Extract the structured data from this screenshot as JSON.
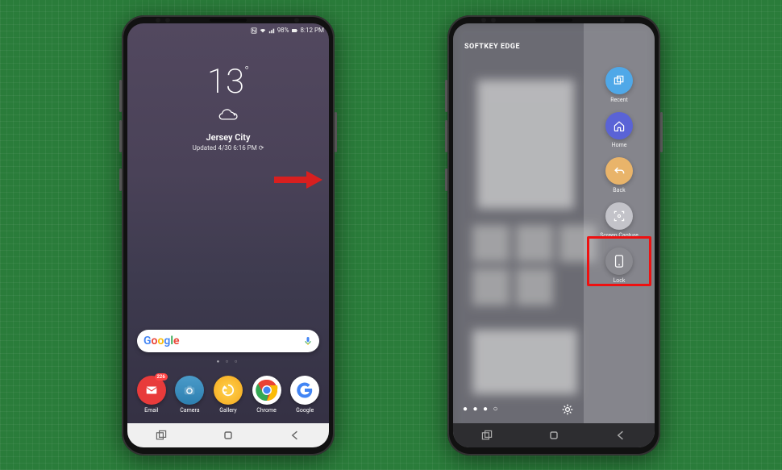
{
  "left": {
    "statusbar": {
      "battery": "98%",
      "time": "8:12 PM"
    },
    "weather": {
      "temp": "13",
      "city": "Jersey City",
      "updated": "Updated 4/30 6:16 PM ⟳"
    },
    "apps": [
      {
        "name": "email",
        "label": "Email",
        "color": "#e83b3b",
        "badge": "226"
      },
      {
        "name": "camera",
        "label": "Camera",
        "color": "#2d7fb0"
      },
      {
        "name": "gallery",
        "label": "Gallery",
        "color": "#f6a81c"
      },
      {
        "name": "chrome",
        "label": "Chrome",
        "color": "#ffffff"
      },
      {
        "name": "google",
        "label": "Google",
        "color": "#ffffff"
      }
    ]
  },
  "right": {
    "title": "SOFTKEY EDGE",
    "items": [
      {
        "name": "recent",
        "label": "Recent",
        "color": "#4fa8e8"
      },
      {
        "name": "home",
        "label": "Home",
        "color": "#5a63d6"
      },
      {
        "name": "back",
        "label": "Back",
        "color": "#e9b46a"
      },
      {
        "name": "screen-capture",
        "label": "Screen Capture",
        "color": "#b7b7bd"
      },
      {
        "name": "lock",
        "label": "Lock",
        "color": "#8a8a90"
      }
    ]
  }
}
